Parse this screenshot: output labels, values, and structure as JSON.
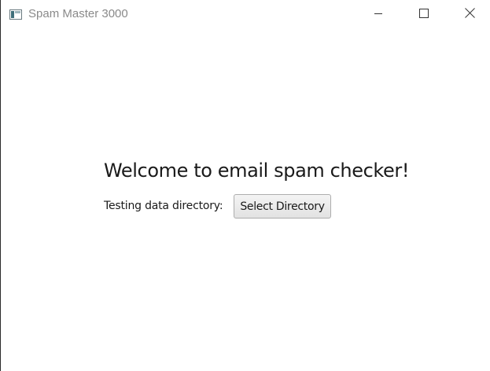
{
  "window": {
    "title": "Spam Master 3000",
    "controls": {
      "minimize": "minimize-icon",
      "maximize": "maximize-icon",
      "close": "close-icon"
    }
  },
  "main": {
    "heading": "Welcome to email spam checker!",
    "directory_label": "Testing data directory:",
    "select_button_label": "Select Directory"
  },
  "colors": {
    "title_text": "#8a8a8a",
    "button_border": "#adadad",
    "button_bg": "#e9e9e9"
  }
}
